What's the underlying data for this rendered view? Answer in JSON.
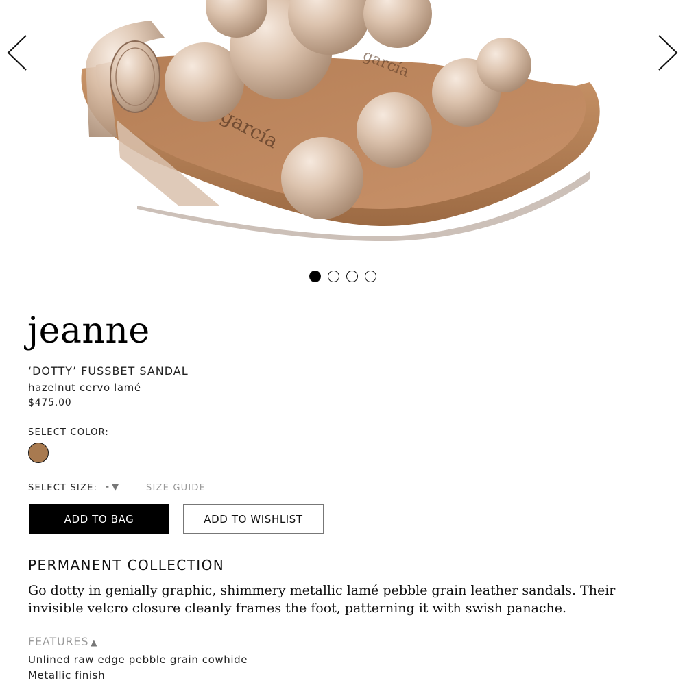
{
  "gallery": {
    "prev_icon": "chevron-left-icon",
    "next_icon": "chevron-right-icon",
    "dots": [
      {
        "active": true
      },
      {
        "active": false
      },
      {
        "active": false
      },
      {
        "active": false
      }
    ],
    "insole_text": "garcía"
  },
  "product": {
    "brand": "jeanne",
    "name": "‘DOTTY’ FUSSBET SANDAL",
    "color_name": "hazelnut cervo lamé",
    "price": "$475.00"
  },
  "color_selector": {
    "label": "SELECT COLOR:",
    "swatches": [
      {
        "color": "#a87a50",
        "selected": true
      }
    ]
  },
  "size_selector": {
    "label": "SELECT SIZE:",
    "value": "-",
    "caret": "▼",
    "guide_label": "SIZE GUIDE"
  },
  "actions": {
    "add_to_bag": "ADD TO BAG",
    "add_to_wishlist": "ADD TO WISHLIST"
  },
  "details": {
    "collection": "PERMANENT COLLECTION",
    "description": "Go dotty in genially graphic, shimmery metallic lamé pebble grain leather sandals. Their invisible velcro closure cleanly frames the foot, patterning it with swish panache.",
    "features_label": "FEATURES",
    "features_caret": "▲",
    "features": [
      "Unlined raw edge pebble grain cowhide",
      "Metallic finish"
    ]
  },
  "colors": {
    "accent": "#000000",
    "muted_text": "#9a9a9a",
    "leather": "#b9875c",
    "metallic": "#e0c7b3"
  }
}
